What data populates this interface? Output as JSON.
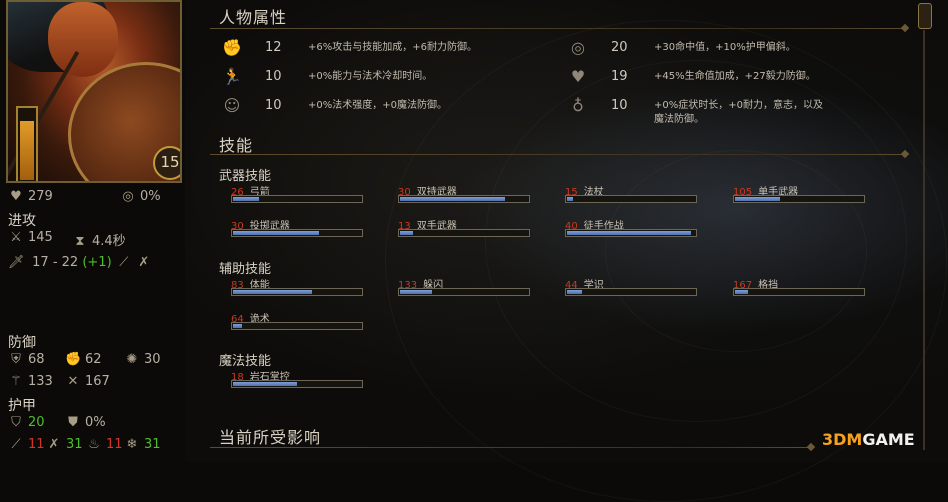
{
  "left": {
    "level": "15",
    "health": "279",
    "accuracy_pct": "0%",
    "hp_fill": 0.85,
    "offense": {
      "title": "进攻",
      "accuracy": "145",
      "attack_speed": "4.4秒",
      "damage": "17 - 22",
      "damage_bonus": "(+1)"
    },
    "defense": {
      "title": "防御",
      "deflection": "68",
      "fortitude": "62",
      "reflex": "30",
      "will": "133",
      "concentration": "167"
    },
    "armor": {
      "title": "护甲",
      "armor_value": "20",
      "penetration": "0%",
      "slash": "11",
      "pierce": "31",
      "burn": "11",
      "freeze": "31"
    }
  },
  "attributes": {
    "title": "人物属性",
    "items": [
      {
        "icon": "fist-icon",
        "value": "12",
        "desc": "+6%攻击与技能加成，+6耐力防御。"
      },
      {
        "icon": "runner-icon",
        "value": "10",
        "desc": "+0%能力与法术冷却时间。"
      },
      {
        "icon": "head-icon",
        "value": "10",
        "desc": "+0%法术强度，+0魔法防御。"
      },
      {
        "icon": "target-icon",
        "value": "20",
        "desc": "+30命中值，+10%护甲偏斜。"
      },
      {
        "icon": "heart-icon",
        "value": "19",
        "desc": "+45%生命值加成，+27毅力防御。"
      },
      {
        "icon": "spirit-icon",
        "value": "10",
        "desc": "+0%症状时长，+0耐力，意志，以及魔法防御。"
      }
    ]
  },
  "skills": {
    "title": "技能",
    "weapon": {
      "title": "武器技能",
      "items": [
        {
          "value": "26",
          "name": "弓箭",
          "fill": 0.2
        },
        {
          "value": "30",
          "name": "双持武器",
          "fill": 0.82
        },
        {
          "value": "15",
          "name": "法杖",
          "fill": 0.05
        },
        {
          "value": "105",
          "name": "单手武器",
          "fill": 0.35
        },
        {
          "value": "30",
          "name": "投掷武器",
          "fill": 0.67
        },
        {
          "value": "13",
          "name": "双手武器",
          "fill": 0.1
        },
        {
          "value": "40",
          "name": "徒手作战",
          "fill": 0.97
        }
      ]
    },
    "support": {
      "title": "辅助技能",
      "items": [
        {
          "value": "83",
          "name": "体能",
          "fill": 0.62
        },
        {
          "value": "133",
          "name": "躲闪",
          "fill": 0.25
        },
        {
          "value": "44",
          "name": "学识",
          "fill": 0.12
        },
        {
          "value": "167",
          "name": "格挡",
          "fill": 0.1
        },
        {
          "value": "64",
          "name": "诡术",
          "fill": 0.07
        }
      ]
    },
    "magic": {
      "title": "魔法技能",
      "items": [
        {
          "value": "18",
          "name": "岩石掌控",
          "fill": 0.5
        }
      ]
    }
  },
  "effects": {
    "title": "当前所受影响"
  },
  "watermark": {
    "prefix": "3DM",
    "suffix": "GAME"
  }
}
